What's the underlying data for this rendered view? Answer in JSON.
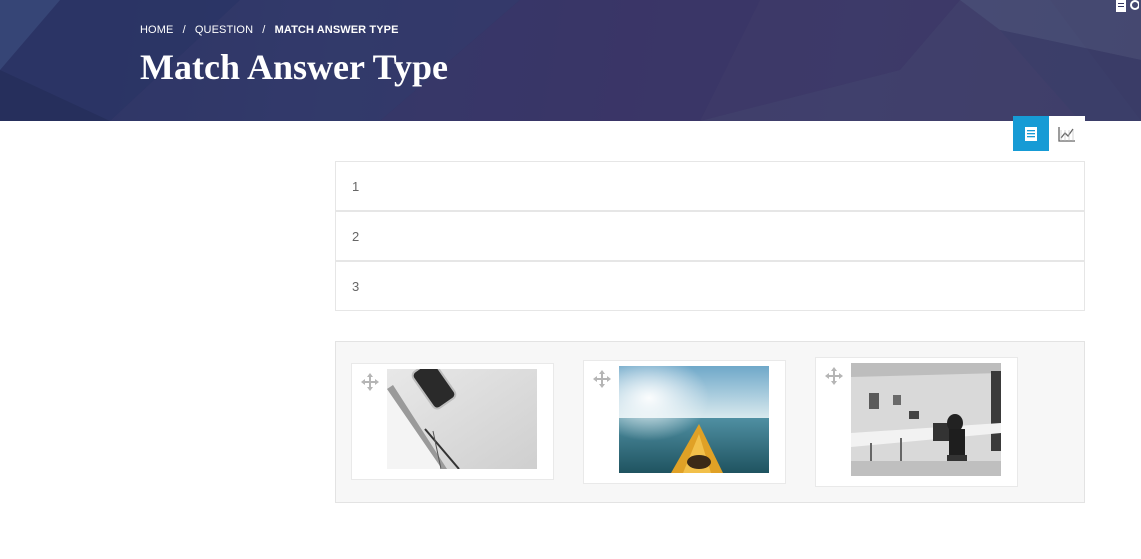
{
  "breadcrumb": {
    "home": "HOME",
    "question": "QUESTION",
    "current": "MATCH ANSWER TYPE",
    "separator": "/"
  },
  "page_title": "Match Answer Type",
  "view_toggle": {
    "icons": [
      "document-icon",
      "chart-icon"
    ],
    "active": "document-icon",
    "active_color": "#169bd5"
  },
  "answer_slots": [
    "1",
    "2",
    "3"
  ],
  "options": [
    {
      "image": "phone-and-notebook-photo"
    },
    {
      "image": "kayak-on-lake-photo"
    },
    {
      "image": "office-workspace-photo"
    }
  ],
  "colors": {
    "banner": "#333663",
    "accent": "#169bd5"
  }
}
